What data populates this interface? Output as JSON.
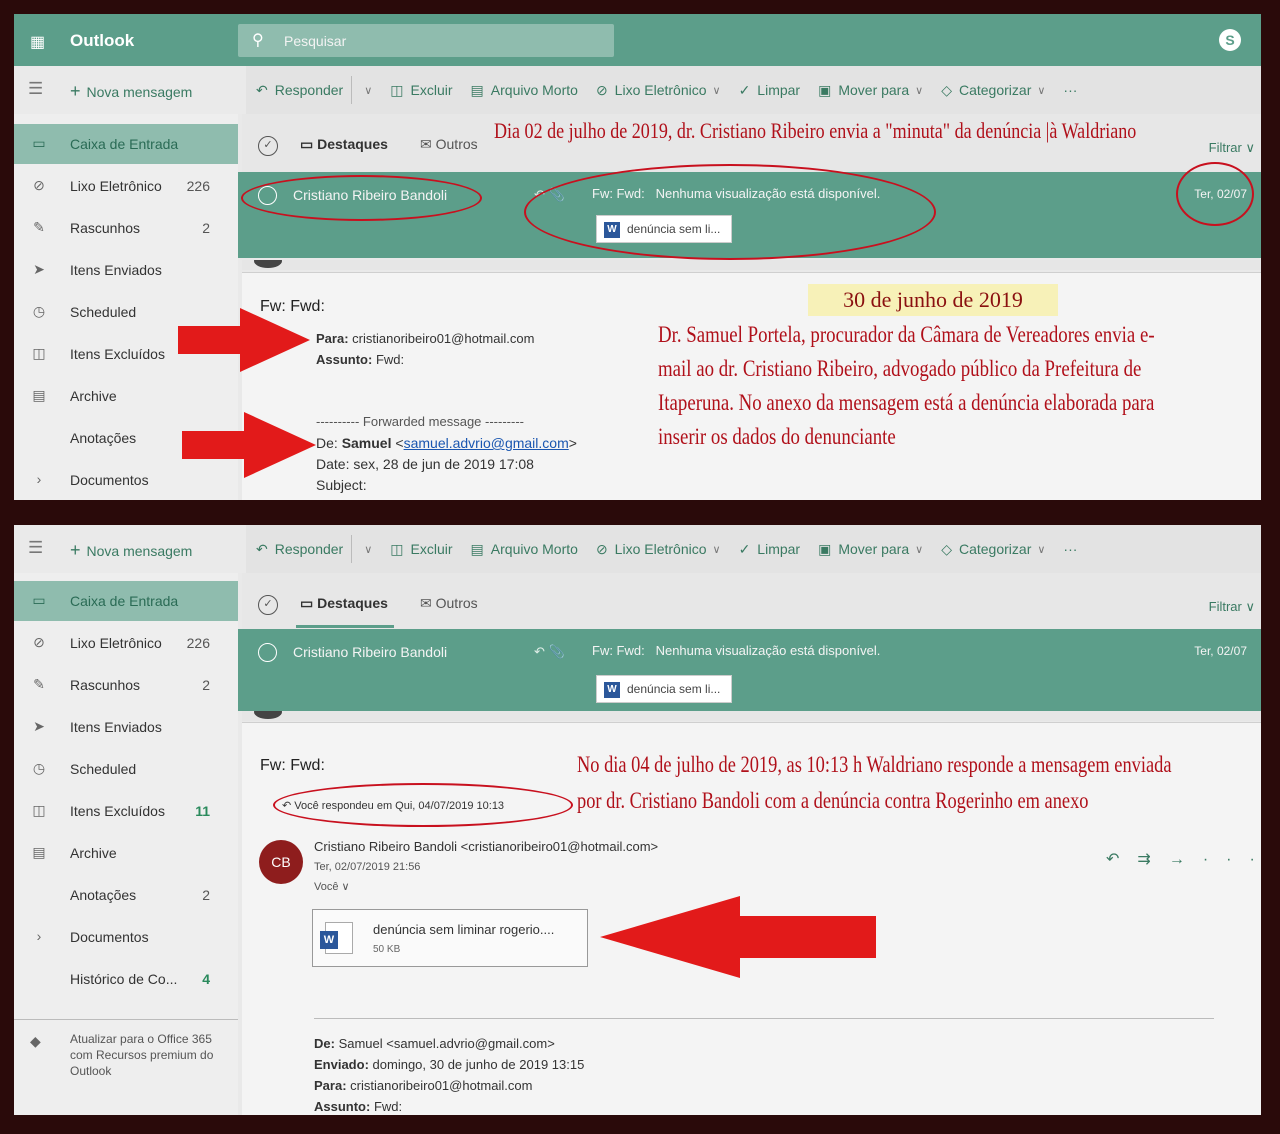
{
  "app": {
    "brand": "Outlook",
    "search_placeholder": "Pesquisar",
    "skype_glyph": "S"
  },
  "toolbar": {
    "new_message": "Nova mensagem",
    "commands": [
      "Responder",
      "Excluir",
      "Arquivo Morto",
      "Lixo Eletrônico",
      "Limpar",
      "Mover para",
      "Categorizar",
      "···"
    ]
  },
  "sidebar": {
    "items": [
      {
        "label": "Caixa de Entrada",
        "count": "",
        "icon": "inbox-icon"
      },
      {
        "label": "Lixo Eletrônico",
        "count": "226",
        "icon": "junk-icon"
      },
      {
        "label": "Rascunhos",
        "count": "2",
        "icon": "pencil-icon"
      },
      {
        "label": "Itens Enviados",
        "count": "",
        "icon": "send-icon"
      },
      {
        "label": "Scheduled",
        "count": "",
        "icon": "clock-icon"
      },
      {
        "label": "Itens Excluídos",
        "count": "11",
        "icon": "trash-icon"
      },
      {
        "label": "Archive",
        "count": "",
        "icon": "archive-icon"
      },
      {
        "label": "Anotações",
        "count": "2",
        "icon": ""
      },
      {
        "label": "Documentos",
        "count": "",
        "icon": "chevron-right-icon"
      },
      {
        "label": "Histórico de Co...",
        "count": "4",
        "icon": ""
      }
    ],
    "promo": "Atualizar para o Office 365 com Recursos premium do Outlook"
  },
  "list": {
    "tab_focused": "Destaques",
    "tab_other": "Outros",
    "filter": "Filtrar",
    "message": {
      "sender": "Cristiano Ribeiro Bandoli",
      "subject": "Fw: Fwd:",
      "preview": "Nenhuma visualização está disponível.",
      "date": "Ter, 02/07",
      "attachment": "denúncia sem li..."
    }
  },
  "reader1": {
    "title": "Fw: Fwd:",
    "to_label": "Para:",
    "to_value": "cristianoribeiro01@hotmail.com",
    "subject_label": "Assunto:",
    "subject_value": "Fwd:",
    "forwarded": "---------- Forwarded message ---------",
    "from_label": "De:",
    "from_name": "Samuel",
    "from_email": "samuel.advrio@gmail.com",
    "date_line": "Date: sex, 28 de jun de 2019 17:08",
    "subject_line": "Subject:"
  },
  "reader2": {
    "title": "Fw: Fwd:",
    "replied": "Você respondeu em Qui, 04/07/2019 10:13",
    "avatar": "CB",
    "sender_line": "Cristiano Ribeiro Bandoli <cristianoribeiro01@hotmail.com>",
    "sent_date": "Ter, 02/07/2019 21:56",
    "recipient": "Você",
    "attachment_name": "denúncia sem liminar rogerio....",
    "attachment_size": "50 KB",
    "quoted_from_label": "De:",
    "quoted_from": "Samuel <samuel.advrio@gmail.com>",
    "quoted_sent_label": "Enviado:",
    "quoted_sent": "domingo, 30 de junho de 2019 13:15",
    "quoted_to_label": "Para:",
    "quoted_to": "cristianoribeiro01@hotmail.com",
    "quoted_subject_label": "Assunto:",
    "quoted_subject": "Fwd:"
  },
  "annotations": {
    "top_header": "Dia 02 de julho de 2019, dr. Cristiano Ribeiro envia a \"minuta\" da denúncia |à Waldriano",
    "date_box": "30 de junho de 2019",
    "body_lines": [
      "Dr. Samuel Portela, procurador da Câmara de Vereadores envia e-",
      "mail ao dr. Cristiano Ribeiro, advogado público da Prefeitura de",
      "Itaperuna. No anexo da mensagem está a denúncia elaborada para",
      "inserir os dados do denunciante"
    ],
    "bottom_lines": [
      "No dia 04 de julho de 2019, as 10:13 h Waldriano responde a mensagem enviada",
      "por dr. Cristiano Bandoli com a denúncia contra Rogerinho em anexo"
    ],
    "color": "#b0101a"
  }
}
